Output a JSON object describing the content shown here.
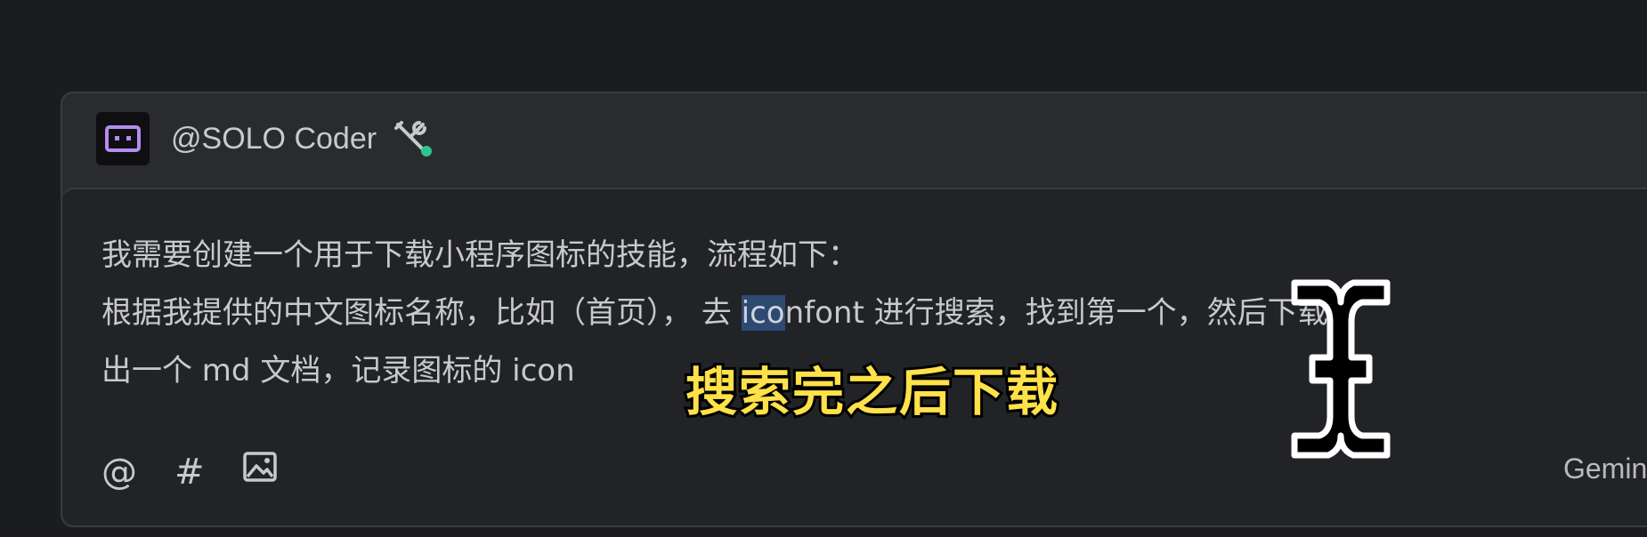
{
  "agent": {
    "name": "@SOLO Coder",
    "status_color": "#2fc58f",
    "avatar_icon": "robot-face-icon",
    "tools_icon": "tools-icon"
  },
  "prompt": {
    "line1": "我需要创建一个用于下载小程序图标的技能，流程如下：",
    "line2_before": "根据我提供的中文图标名称，比如（首页）， 去 ",
    "line2_selected": "ico",
    "line2_after": "nfont 进行搜索，找到第一个，然后下载",
    "line3": "出一个 md 文档，记录图标的 icon"
  },
  "toolbar": {
    "mention_label": "@",
    "hashtag_label": "#",
    "image_icon": "image-icon"
  },
  "model": {
    "label": "Gemini-"
  },
  "subtitle": {
    "text": "搜索完之后下载"
  },
  "colors": {
    "background": "#1b1c1f",
    "panel": "#2a2b2f",
    "input": "#222327",
    "selection": "#2d4a73",
    "subtitle": "#ffe14a"
  }
}
